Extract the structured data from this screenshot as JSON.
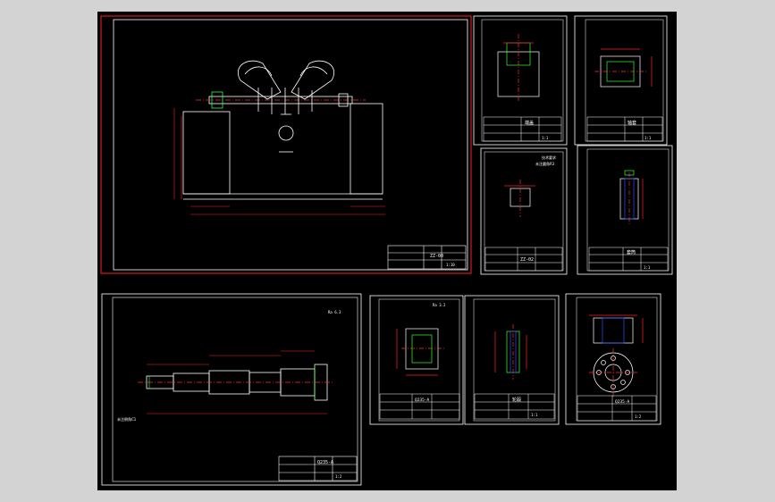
{
  "colors": {
    "background": "#000000",
    "outer_frame": "#d3d3d3",
    "line_white": "#ffffff",
    "dimension_red": "#ff2020",
    "centerline": "#ff3030",
    "accent_green": "#33ff33",
    "accent_yellow": "#ffff00",
    "hatch_blue": "#3050ff"
  },
  "sheets": {
    "assembly": {
      "title_code": "ZZ-00",
      "scale_note": "1:10"
    },
    "shaft": {
      "material": "Q235-A",
      "scale_note": "1:2",
      "tolerance_note": "Ra 6.3",
      "tech_note": "未注倒角C1"
    },
    "bracket": {
      "note_lines": [
        "技术要求",
        "未注圆角R3"
      ],
      "part_no": "ZZ-02"
    },
    "cap_top": {
      "part_name": "端盖",
      "scale_note": "1:1"
    },
    "bearing_seat": {
      "material": "Q235-A",
      "tech_note": "Ra 3.2"
    },
    "bushing": {
      "part_name": "轴套",
      "scale_note": "1:1"
    },
    "gear_hub": {
      "part_name": "轮毂",
      "scale_note": "1:1"
    },
    "sleeve": {
      "part_name": "套筒",
      "scale_note": "1:1"
    },
    "flange": {
      "material": "Q235-A",
      "scale_note": "1:2"
    }
  }
}
